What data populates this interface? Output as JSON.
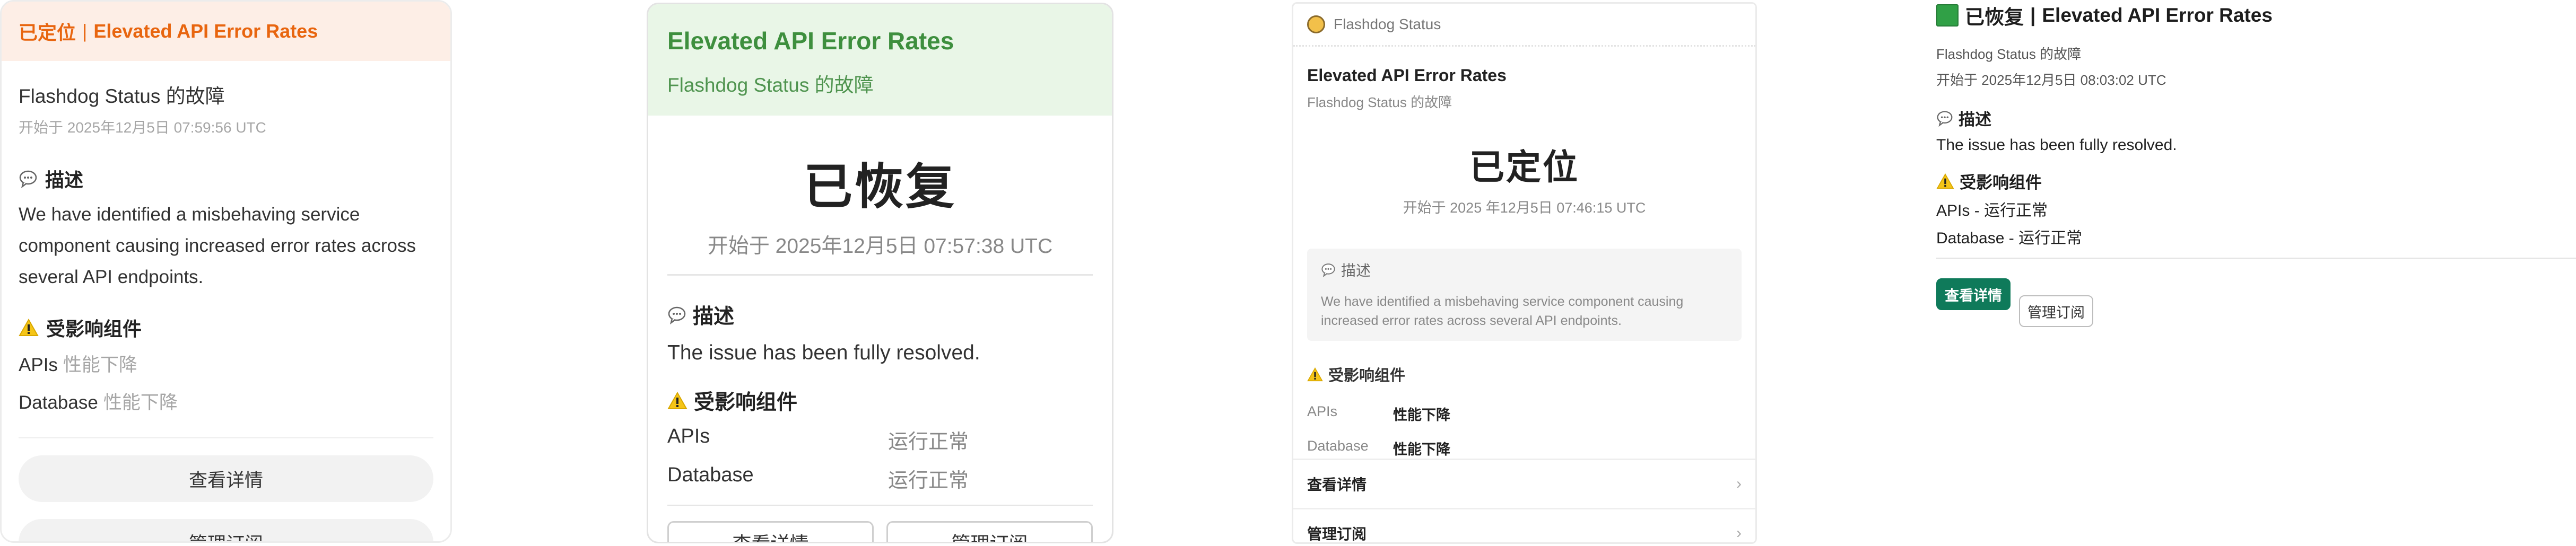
{
  "card1": {
    "status": "已定位",
    "separator": "|",
    "incident_title": "Elevated API Error Rates",
    "source": "Flashdog Status 的故障",
    "started": "开始于 2025年12月5日 07:59:56 UTC",
    "description_heading": "描述",
    "description": "We have identified a misbehaving service component causing increased error rates across several API endpoints.",
    "components_heading": "受影响组件",
    "components": [
      {
        "name": "APIs",
        "status": "性能下降"
      },
      {
        "name": "Database",
        "status": "性能下降"
      }
    ],
    "view_details": "查看详情",
    "manage_subscription": "管理订阅"
  },
  "card2": {
    "incident_title": "Elevated API Error Rates",
    "source": "Flashdog Status 的故障",
    "status": "已恢复",
    "started": "开始于 2025年12月5日 07:57:38 UTC",
    "description_heading": "描述",
    "description": "The issue has been fully resolved.",
    "components_heading": "受影响组件",
    "components": [
      {
        "name": "APIs",
        "status": "运行正常"
      },
      {
        "name": "Database",
        "status": "运行正常"
      }
    ],
    "view_details": "查看详情",
    "manage_subscription": "管理订阅"
  },
  "card3": {
    "app_name": "Flashdog Status",
    "incident_title": "Elevated API Error Rates",
    "source": "Flashdog Status 的故障",
    "status": "已定位",
    "started": "开始于 2025 年12月5日 07:46:15 UTC",
    "description_heading": "描述",
    "description": "We have identified a misbehaving service component causing increased error rates across several API endpoints.",
    "components_heading": "受影响组件",
    "components": [
      {
        "name": "APIs",
        "status": "性能下降"
      },
      {
        "name": "Database",
        "status": "性能下降"
      }
    ],
    "view_details": "查看详情",
    "manage_subscription": "管理订阅"
  },
  "card4": {
    "status": "已恢复",
    "separator": "|",
    "incident_title": "Elevated API Error Rates",
    "source": "Flashdog Status 的故障",
    "started": "开始于 2025年12月5日 08:03:02 UTC",
    "description_heading": "描述",
    "description": "The issue has been fully resolved.",
    "components_heading": "受影响组件",
    "components": [
      {
        "name": "APIs",
        "sep": "-",
        "status": "运行正常"
      },
      {
        "name": "Database",
        "sep": "-",
        "status": "运行正常"
      }
    ],
    "view_details": "查看详情",
    "manage_subscription": "管理订阅"
  },
  "icons": {
    "speech": "speech-bubble-icon",
    "warning": "warning-icon",
    "check": "green-square-icon",
    "chevron": "chevron-right-icon"
  },
  "colors": {
    "located_orange": "#e8650f",
    "resolved_green": "#3e8f3e",
    "primary_button": "#0f7a5a"
  }
}
